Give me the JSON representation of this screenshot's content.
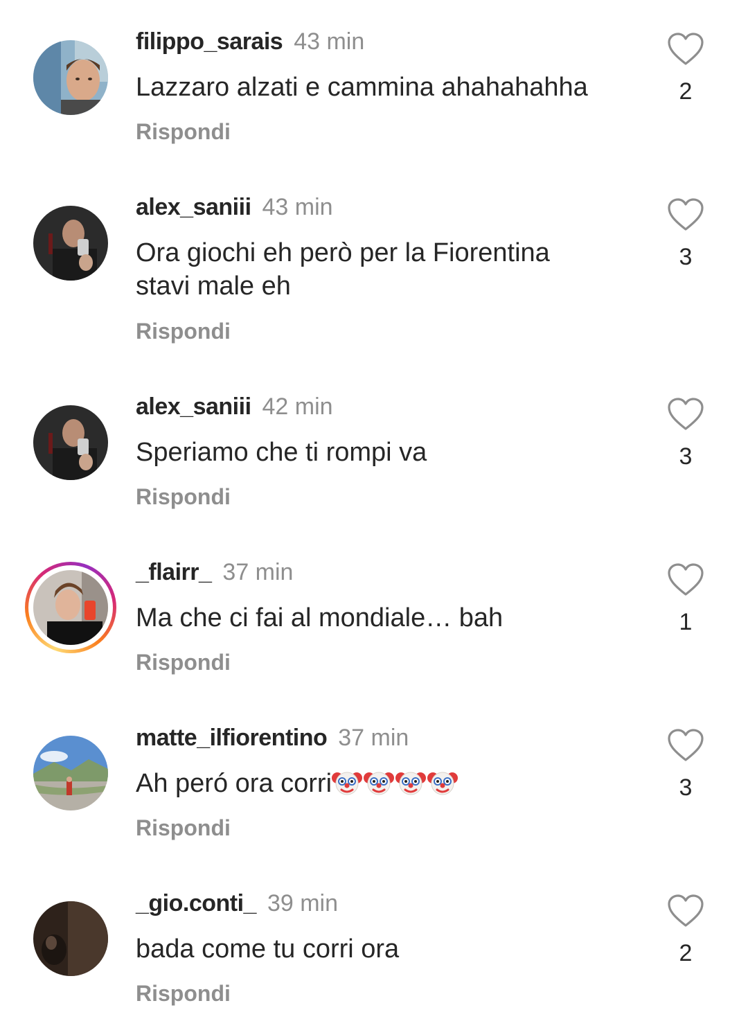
{
  "reply_label": "Rispondi",
  "comments": [
    {
      "username": "filippo_sarais",
      "time": "43 min",
      "text": "Lazzaro alzati e cammina ahahahahha",
      "likes": "2",
      "avatar_icon": "man-face-avatar"
    },
    {
      "username": "alex_saniii",
      "time": "43 min",
      "text": "Ora giochi eh però per la Fiorentina stavi male eh",
      "likes": "3",
      "avatar_icon": "dark-selfie-avatar"
    },
    {
      "username": "alex_saniii",
      "time": "42 min",
      "text": "Speriamo che ti rompi va",
      "likes": "3",
      "avatar_icon": "dark-selfie-avatar"
    },
    {
      "username": "_flairr_",
      "time": "37 min",
      "text": "Ma che ci fai al mondiale… bah",
      "likes": "1",
      "avatar_icon": "mirror-selfie-avatar",
      "has_story": true
    },
    {
      "username": "matte_ilfiorentino",
      "time": "37 min",
      "text": "Ah peró ora corri",
      "emoji": "🤡🤡🤡🤡",
      "emoji_name": "clown-face",
      "emoji_count": 4,
      "likes": "3",
      "avatar_icon": "mountain-landscape-avatar"
    },
    {
      "username": "_gio.conti_",
      "time": "39 min",
      "text": "bada come tu corri ora",
      "likes": "2",
      "avatar_icon": "dark-room-avatar"
    }
  ],
  "colors": {
    "primary_text": "#262626",
    "secondary_text": "#8e8e8e",
    "background": "#ffffff"
  }
}
